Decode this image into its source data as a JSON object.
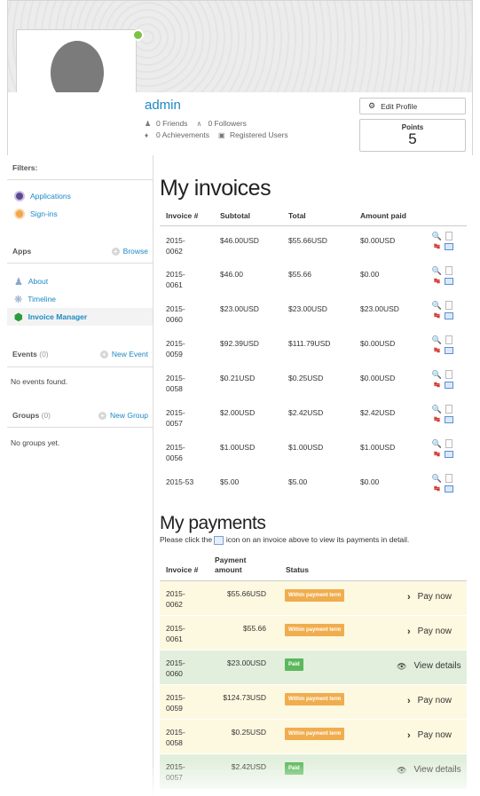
{
  "profile": {
    "username": "admin",
    "friends": "0 Friends",
    "followers": "0 Followers",
    "achievements": "0 Achievements",
    "group": "Registered Users",
    "edit_label": "Edit Profile",
    "points_label": "Points",
    "points_value": "5",
    "online_color": "#7dc242"
  },
  "sidebar": {
    "filters_title": "Filters:",
    "filters": [
      {
        "label": "Applications",
        "icon": "applications-icon"
      },
      {
        "label": "Sign-ins",
        "icon": "signins-icon"
      }
    ],
    "apps_title": "Apps",
    "browse_label": "Browse",
    "apps": [
      {
        "label": "About",
        "icon": "user-icon"
      },
      {
        "label": "Timeline",
        "icon": "timeline-icon"
      },
      {
        "label": "Invoice Manager",
        "icon": "invoice-manager-icon"
      }
    ],
    "events_title": "Events",
    "events_count": "(0)",
    "new_event_label": "New Event",
    "events_empty": "No events found.",
    "groups_title": "Groups",
    "groups_count": "(0)",
    "new_group_label": "New Group",
    "groups_empty": "No groups yet."
  },
  "invoices": {
    "title": "My invoices",
    "headers": [
      "Invoice #",
      "Subtotal",
      "Total",
      "Amount paid"
    ],
    "rows": [
      {
        "id": "2015-\n0062",
        "subtotal": "$46.00USD",
        "total": "$55.66USD",
        "paid": "$0.00USD"
      },
      {
        "id": "2015-\n0061",
        "subtotal": "$46.00",
        "total": "$55.66",
        "paid": "$0.00"
      },
      {
        "id": "2015-\n0060",
        "subtotal": "$23.00USD",
        "total": "$23.00USD",
        "paid": "$23.00USD"
      },
      {
        "id": "2015-\n0059",
        "subtotal": "$92.39USD",
        "total": "$111.79USD",
        "paid": "$0.00USD"
      },
      {
        "id": "2015-\n0058",
        "subtotal": "$0.21USD",
        "total": "$0.25USD",
        "paid": "$0.00USD"
      },
      {
        "id": "2015-\n0057",
        "subtotal": "$2.00USD",
        "total": "$2.42USD",
        "paid": "$2.42USD"
      },
      {
        "id": "2015-\n0056",
        "subtotal": "$1.00USD",
        "total": "$1.00USD",
        "paid": "$1.00USD"
      },
      {
        "id": "2015-53",
        "subtotal": "$5.00",
        "total": "$5.00",
        "paid": "$0.00"
      }
    ]
  },
  "payments": {
    "title": "My payments",
    "note_before": "Please click the",
    "note_after": "icon on an invoice above to view its payments in detail.",
    "headers": [
      "Invoice #",
      "Payment\namount",
      "Status"
    ],
    "rows": [
      {
        "id": "2015-\n0062",
        "amount": "$55.66USD",
        "status": "Within payment term",
        "state": "pending",
        "action": "Pay now"
      },
      {
        "id": "2015-\n0061",
        "amount": "$55.66",
        "status": "Within payment term",
        "state": "pending",
        "action": "Pay now"
      },
      {
        "id": "2015-\n0060",
        "amount": "$23.00USD",
        "status": "Paid",
        "state": "paid",
        "action": "View details"
      },
      {
        "id": "2015-\n0059",
        "amount": "$124.73USD",
        "status": "Within payment term",
        "state": "pending",
        "action": "Pay now"
      },
      {
        "id": "2015-\n0058",
        "amount": "$0.25USD",
        "status": "Within payment term",
        "state": "pending",
        "action": "Pay now"
      },
      {
        "id": "2015-\n0057",
        "amount": "$2.42USD",
        "status": "Paid",
        "state": "paid",
        "action": "View details"
      }
    ]
  }
}
